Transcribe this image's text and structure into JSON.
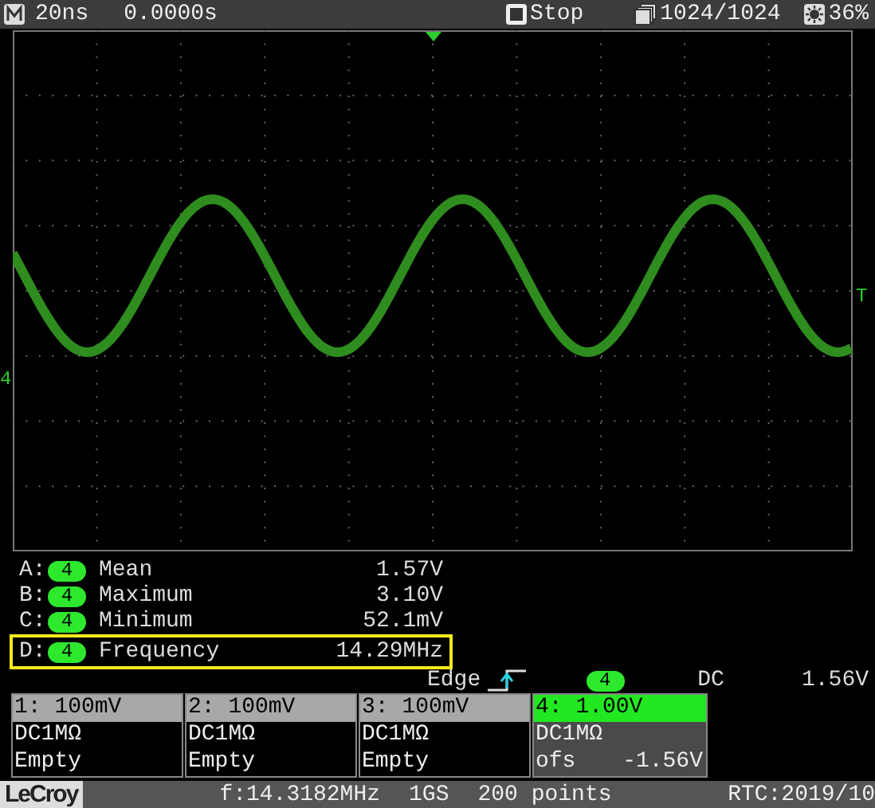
{
  "top_bar": {
    "timebase": "20ns",
    "delay": "0.0000s",
    "run_state": "Stop",
    "acquisitions": "1024/1024",
    "brightness": "36%"
  },
  "display": {
    "channel_marker": "4",
    "trigger_marker": "T"
  },
  "measurements": [
    {
      "slot": "A:",
      "channel": "4",
      "name": "Mean",
      "value": "1.57V",
      "selected": false
    },
    {
      "slot": "B:",
      "channel": "4",
      "name": "Maximum",
      "value": "3.10V",
      "selected": false
    },
    {
      "slot": "C:",
      "channel": "4",
      "name": "Minimum",
      "value": "52.1mV",
      "selected": false
    },
    {
      "slot": "D:",
      "channel": "4",
      "name": "Frequency",
      "value": "14.29MHz",
      "selected": true
    }
  ],
  "trigger": {
    "type": "Edge",
    "channel": "4",
    "coupling": "DC",
    "level": "1.56V"
  },
  "channels": [
    {
      "scale": "1: 100mV",
      "coupling": "DC1MΩ",
      "status": "Empty",
      "active": false
    },
    {
      "scale": "2: 100mV",
      "coupling": "DC1MΩ",
      "status": "Empty",
      "active": false
    },
    {
      "scale": "3: 100mV",
      "coupling": "DC1MΩ",
      "status": "Empty",
      "active": false
    },
    {
      "scale": "4: 1.00V",
      "coupling": "DC1MΩ",
      "status": "ofs",
      "offset": "-1.56V",
      "active": true
    }
  ],
  "status_bar": {
    "logo": "LeCroy",
    "frequency": "f:14.3182MHz",
    "sample_rate": "1GS",
    "points": "200 points",
    "rtc": "RTC:2019/10"
  }
}
